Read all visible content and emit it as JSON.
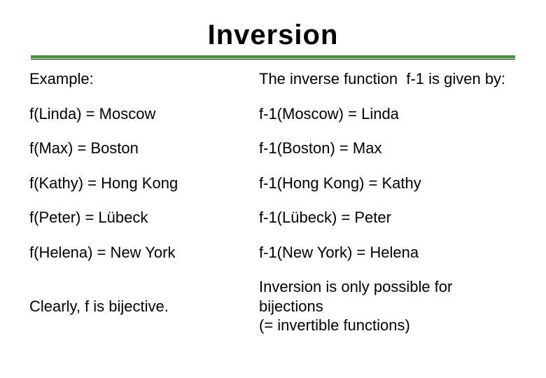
{
  "title": "Inversion",
  "rows": [
    {
      "left": "Example:",
      "right": "The inverse function  f-1 is given by:"
    },
    {
      "left": "f(Linda) = Moscow",
      "right": "f-1(Moscow) = Linda"
    },
    {
      "left": "f(Max) = Boston",
      "right": "f-1(Boston) = Max"
    },
    {
      "left": "f(Kathy) = Hong Kong",
      "right": "f-1(Hong Kong) = Kathy"
    },
    {
      "left": "f(Peter) = Lübeck",
      "right": "f-1(Lübeck) = Peter"
    },
    {
      "left": "f(Helena) = New York",
      "right": "f-1(New York) = Helena"
    },
    {
      "left": "\nClearly, f is bijective.",
      "right": "Inversion is only possible for bijections\n(= invertible functions)"
    }
  ]
}
